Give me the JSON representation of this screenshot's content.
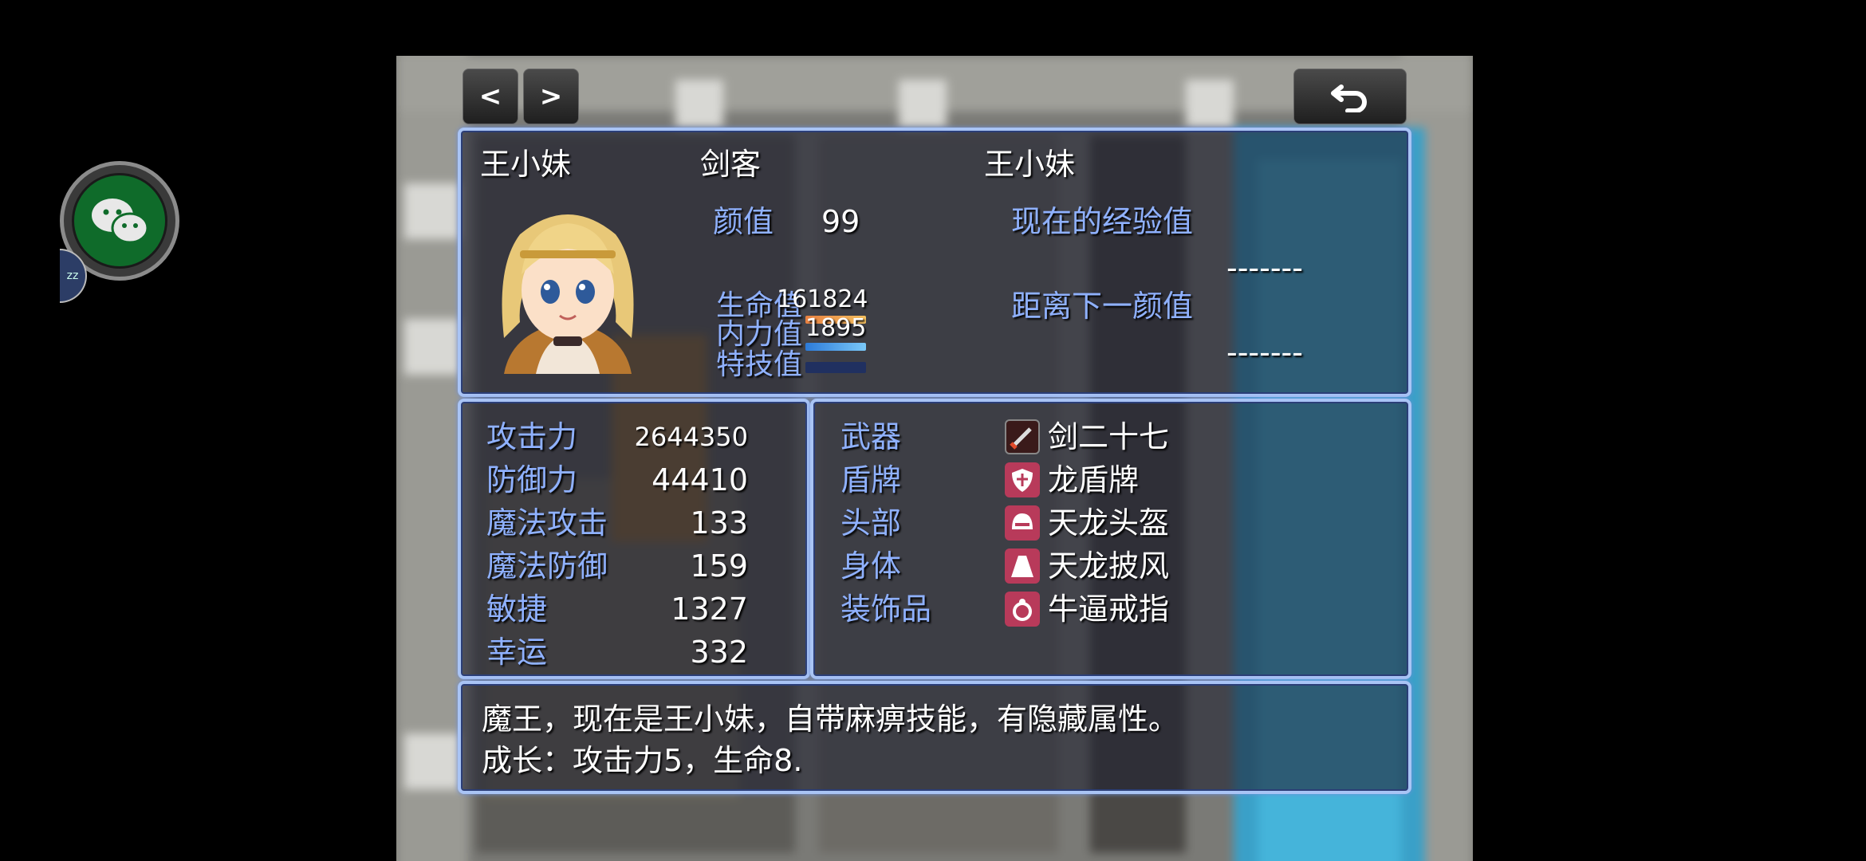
{
  "nav": {
    "prev_label": "<",
    "next_label": ">",
    "back_icon": "undo-arrow-icon"
  },
  "header": {
    "name": "王小妹",
    "class": "剑客",
    "nickname": "王小妹",
    "stat_label": "颜值",
    "stat_value": "99",
    "exp_label": "现在的经验值",
    "exp_value": "-------",
    "next_label": "距离下一颜值",
    "next_value": "-------",
    "hp_label": "生命值",
    "hp_value": "161824",
    "mp_label": "内力值",
    "mp_value": "1895",
    "tp_label": "特技值",
    "bar_colors": {
      "hp": "#f0a050",
      "mp": "#4aa0e8",
      "tp": "#203060"
    }
  },
  "stats": [
    {
      "label": "攻击力",
      "value": "2644350"
    },
    {
      "label": "防御力",
      "value": "44410"
    },
    {
      "label": "魔法攻击",
      "value": "133"
    },
    {
      "label": "魔法防御",
      "value": "159"
    },
    {
      "label": "敏捷",
      "value": "1327"
    },
    {
      "label": "幸运",
      "value": "332"
    }
  ],
  "equipment": [
    {
      "slot": "武器",
      "item": "剑二十七",
      "icon": "sword-icon"
    },
    {
      "slot": "盾牌",
      "item": "龙盾牌",
      "icon": "shield-icon"
    },
    {
      "slot": "头部",
      "item": "天龙头盔",
      "icon": "helmet-icon"
    },
    {
      "slot": "身体",
      "item": "天龙披风",
      "icon": "cloak-icon"
    },
    {
      "slot": "装饰品",
      "item": "牛逼戒指",
      "icon": "ring-icon"
    }
  ],
  "description": {
    "line1": "魔王，现在是王小妹，自带麻痹技能，有隐藏属性。",
    "line2": "成长：攻击力5，生命8."
  },
  "overlay": {
    "app_icon": "wechat-icon",
    "badge_text": "zz"
  },
  "colors": {
    "panel_border": "#a9c4f5",
    "label_blue": "#8fb1ff",
    "text_white": "#ffffff"
  }
}
